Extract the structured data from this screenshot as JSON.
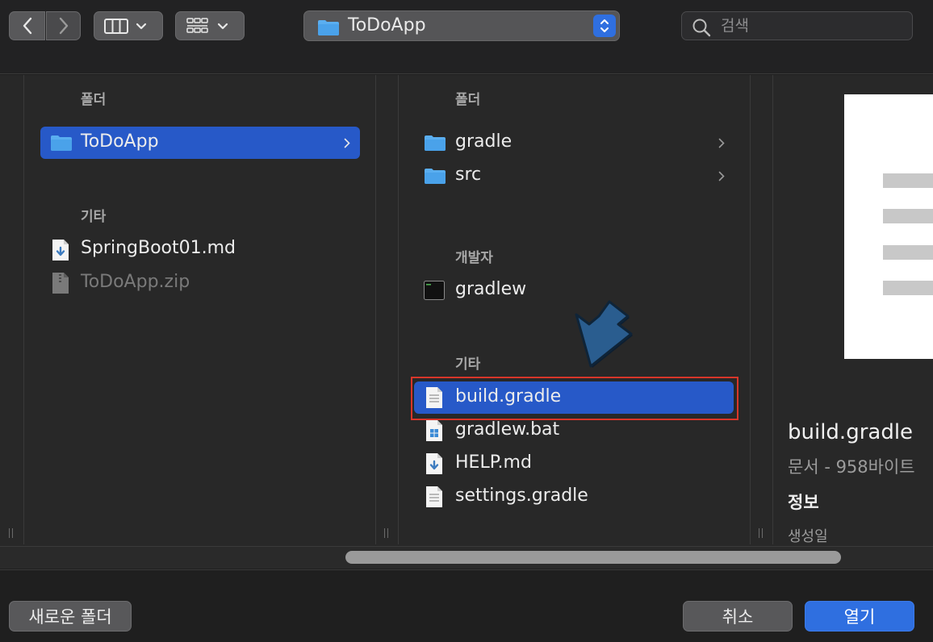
{
  "toolbar": {
    "path_popup": {
      "label": "ToDoApp",
      "icon": "folder-icon"
    },
    "search": {
      "placeholder": "검색",
      "value": ""
    }
  },
  "column1": {
    "folders_header": "폴더",
    "folders": [
      {
        "name": "ToDoApp",
        "icon": "folder-icon",
        "selected": true
      }
    ],
    "other_header": "기타",
    "other": [
      {
        "name": "SpringBoot01.md",
        "icon": "markdown-file-icon",
        "disabled": false
      },
      {
        "name": "ToDoApp.zip",
        "icon": "zip-file-icon",
        "disabled": true
      }
    ]
  },
  "column2": {
    "folders_header": "폴더",
    "folders": [
      {
        "name": "gradle",
        "icon": "folder-icon"
      },
      {
        "name": "src",
        "icon": "folder-icon"
      }
    ],
    "developer_header": "개발자",
    "developer": [
      {
        "name": "gradlew",
        "icon": "terminal-exec-icon"
      }
    ],
    "other_header": "기타",
    "other": [
      {
        "name": "build.gradle",
        "icon": "document-icon",
        "selected": true
      },
      {
        "name": "gradlew.bat",
        "icon": "windows-bat-icon"
      },
      {
        "name": "HELP.md",
        "icon": "markdown-file-icon"
      },
      {
        "name": "settings.gradle",
        "icon": "document-icon"
      }
    ]
  },
  "preview": {
    "name": "build.gradle",
    "kind": "문서 - 958바이트",
    "info_header": "정보",
    "created_label": "생성일"
  },
  "bottom": {
    "new_folder": "새로운 폴더",
    "cancel": "취소",
    "open": "열기"
  },
  "colors": {
    "selection": "#2759c8",
    "primary_button": "#2f6fe0",
    "annotation_border": "#d8362a",
    "annotation_arrow": "#2a5d8f"
  }
}
